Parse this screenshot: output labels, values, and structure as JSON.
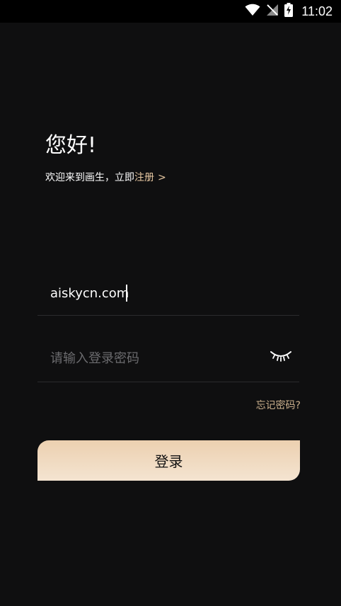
{
  "status_bar": {
    "time": "11:02",
    "icons": [
      "wifi-icon",
      "no-signal-icon",
      "battery-charging-icon"
    ]
  },
  "header": {
    "greeting": "您好!",
    "welcome_text": "欢迎来到画生，立即",
    "register_link": "注册",
    "register_arrow": ">"
  },
  "form": {
    "account_value": "aiskycn.com",
    "password_placeholder": "请输入登录密码",
    "password_toggle_icon": "eye-closed-icon",
    "forgot_link": "忘记密码?",
    "login_label": "登录"
  },
  "colors": {
    "background": "#0f0f10",
    "accent": "#e9c9a3",
    "button_gradient_top": "#ecd0b0",
    "button_gradient_bottom": "#f4e4d1",
    "divider": "#2b2b2d"
  }
}
